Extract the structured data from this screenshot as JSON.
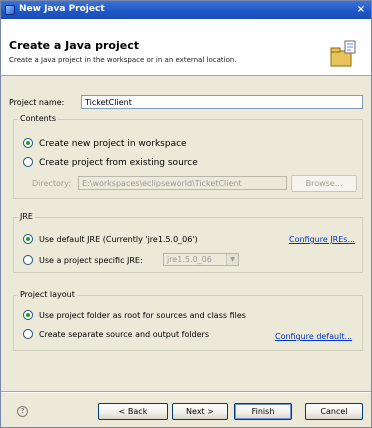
{
  "window": {
    "title": "New Java Project",
    "close_glyph": "×"
  },
  "banner": {
    "title": "Create a Java project",
    "description": "Create a Java project in the workspace or in an external location.",
    "icon": "java-project-wizard-icon"
  },
  "project_name": {
    "label": "Project name:",
    "value": "TicketClient"
  },
  "contents": {
    "group_title": "Contents",
    "option_new": "Create new project in workspace",
    "option_existing": "Create project from existing source",
    "directory_label": "Directory:",
    "directory_value": "E:\\workspaces\\eclipseworld\\TicketClient",
    "browse_label": "Browse..."
  },
  "jre": {
    "group_title": "JRE",
    "option_default": "Use default JRE (Currently 'jre1.5.0_06')",
    "configure_link": "Configure JREs...",
    "option_specific": "Use a project specific JRE:",
    "specific_value": "jre1.5.0_06"
  },
  "layout": {
    "group_title": "Project layout",
    "option_root": "Use project folder as root for sources and class files",
    "option_separate": "Create separate source and output folders",
    "configure_link": "Configure default..."
  },
  "footer": {
    "help_glyph": "?",
    "back_label": "< Back",
    "next_label": "Next >",
    "finish_label": "Finish",
    "cancel_label": "Cancel"
  },
  "colors": {
    "accent": "#1f56c8",
    "link": "#0033cc",
    "dialog_bg": "#ece9d8"
  }
}
